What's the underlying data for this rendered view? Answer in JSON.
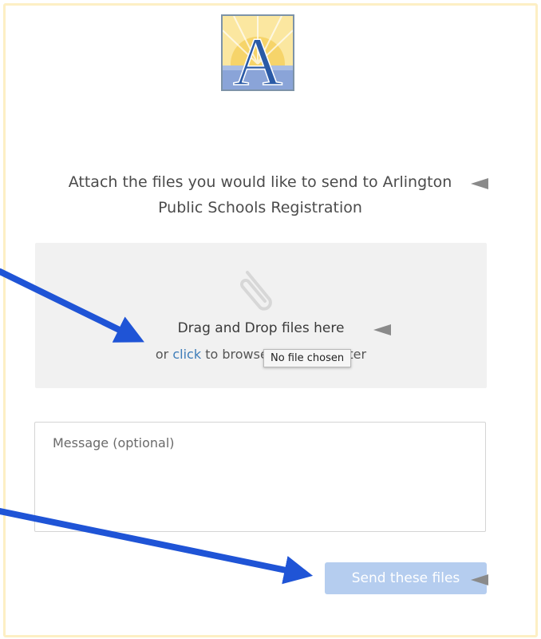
{
  "form": {
    "intro_text": "Attach the files you would like to send to Arlington Public Schools Registration",
    "logo_letter": "A",
    "dropzone": {
      "title": "Drag and Drop files here",
      "browse_prefix": "or",
      "browse_link": "click",
      "browse_suffix": "to browse your computer",
      "file_input_tooltip": "No file chosen"
    },
    "message": {
      "placeholder": "Message (optional)",
      "value": ""
    },
    "send_button_label": "Send these files"
  },
  "colors": {
    "frame_border": "#fdefc4",
    "dropzone_bg": "#f1f1f1",
    "link": "#3d7cb8",
    "send_button_bg": "#b5cdef",
    "annotation_arrow": "#1f54d6",
    "marker": "#8a8a8a"
  },
  "icons": {
    "logo": "arlington-a-logo",
    "dropzone": "paperclip-icon"
  }
}
